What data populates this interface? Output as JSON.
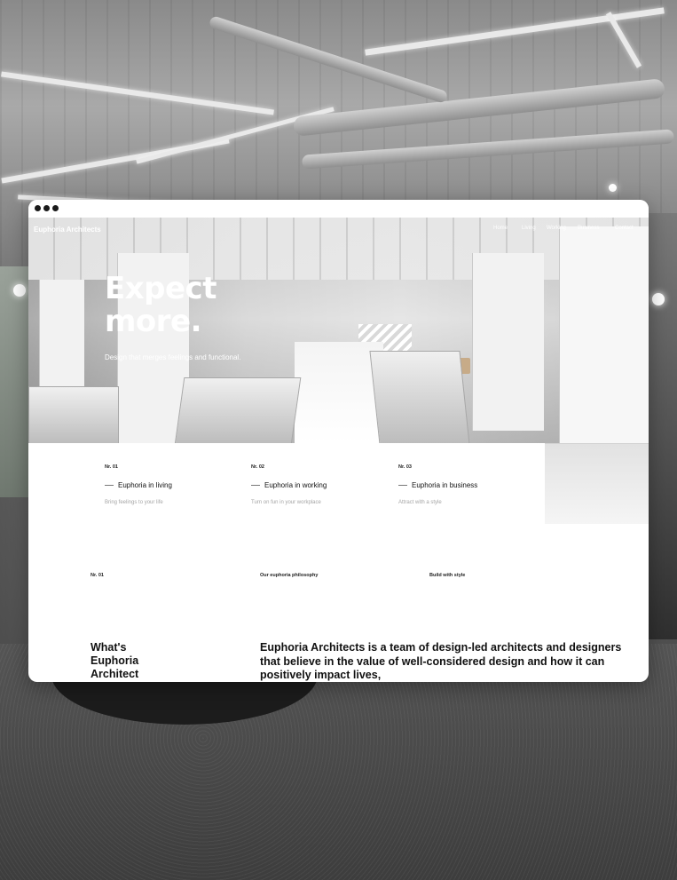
{
  "site": {
    "brand": "Euphoria Architects",
    "nav": [
      "Home",
      "Living",
      "Working",
      "Business",
      "Contact"
    ]
  },
  "hero": {
    "headline_line1": "Expect",
    "headline_line2": "more.",
    "subtitle": "Design that merges feelings and functional."
  },
  "features": [
    {
      "number": "Nr. 01",
      "title": "Euphoria in living",
      "description": "Bring feelings to your life"
    },
    {
      "number": "Nr. 02",
      "title": "Euphoria in working",
      "description": "Turn on fun in your workplace"
    },
    {
      "number": "Nr. 03",
      "title": "Euphoria in business",
      "description": "Attract with a style"
    }
  ],
  "sections": {
    "labels": [
      "Nr. 01",
      "Our euphoria philosophy",
      "Build with style"
    ],
    "what_heading_line1": "What's",
    "what_heading_line2": "Euphoria",
    "what_heading_line3": "Architect",
    "about_text": "Euphoria Architects is a team of design-led architects and designers that believe in the value of well-considered design and how it can positively impact lives,"
  },
  "window": {
    "controls": [
      "window-dot",
      "window-dot",
      "window-dot"
    ]
  }
}
